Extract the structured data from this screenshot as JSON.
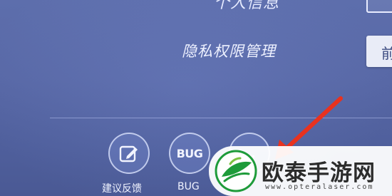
{
  "settings": {
    "top_row_label": "个人信息",
    "privacy_label": "隐私权限管理",
    "manage_button_label": "前"
  },
  "bottom_actions": [
    {
      "label": "建议反馈",
      "icon": "edit-icon"
    },
    {
      "label": "BUG",
      "icon_text": "BUG"
    },
    {
      "label": "",
      "icon_text": "…"
    }
  ],
  "watermark": {
    "brand": "欧泰手游网",
    "url": "www.opteralaser.com"
  },
  "colors": {
    "background": "#5868a6",
    "arrow": "#e8321f",
    "logo_green": "#1e9b3a"
  }
}
